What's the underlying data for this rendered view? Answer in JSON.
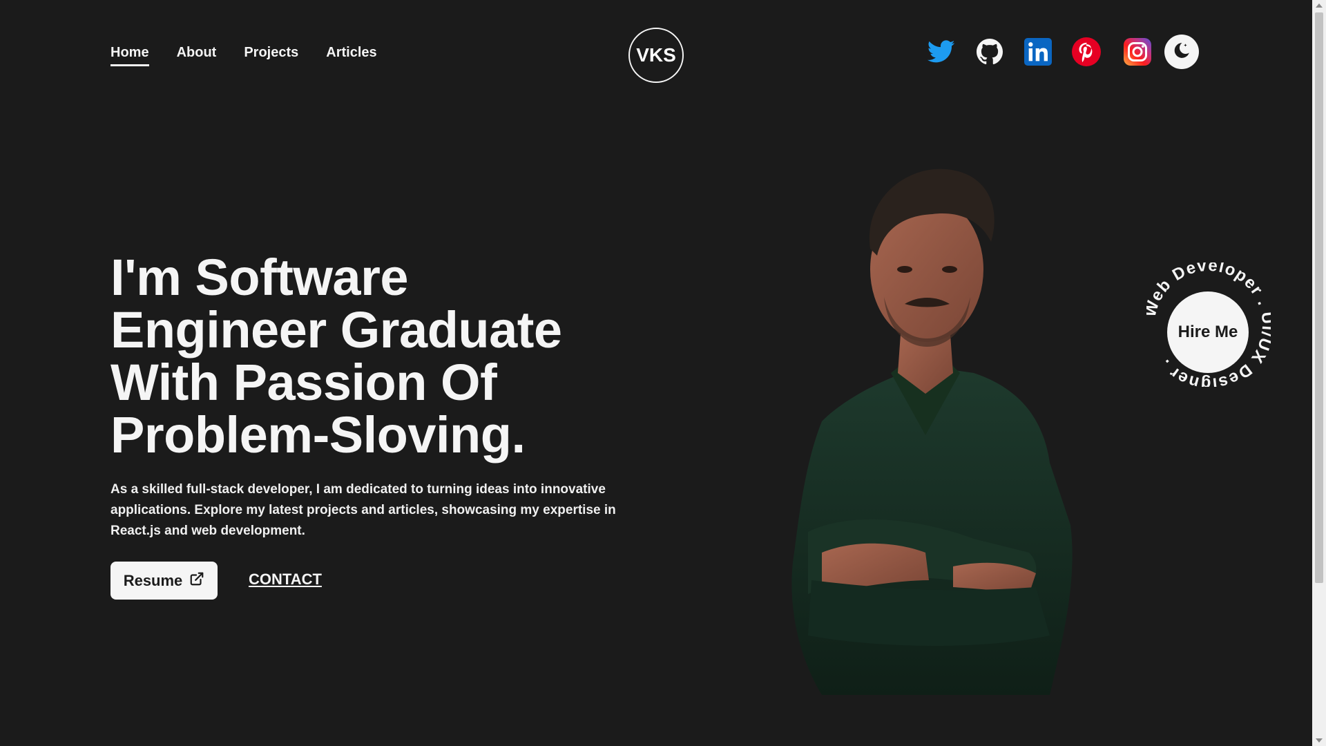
{
  "nav": {
    "items": [
      {
        "label": "Home",
        "active": true
      },
      {
        "label": "About",
        "active": false
      },
      {
        "label": "Projects",
        "active": false
      },
      {
        "label": "Articles",
        "active": false
      }
    ]
  },
  "logo": {
    "text": "VKS"
  },
  "social": {
    "icons": [
      "twitter-icon",
      "github-icon",
      "linkedin-icon",
      "pinterest-icon",
      "instagram-icon"
    ],
    "theme_icon": "moon-icon"
  },
  "hero": {
    "headline_lines": [
      "I'm Software",
      "Engineer Graduate",
      "With Passion Of",
      "Problem-Sloving."
    ],
    "intro": "As a skilled full-stack developer, I am dedicated to turning ideas into innovative applications. Explore my latest projects and articles, showcasing my expertise in React.js and web development.",
    "resume_label": "Resume",
    "contact_label": "CONTACT"
  },
  "hire": {
    "label": "Hire Me",
    "ring_text": "Web Developer . UI/UX Designer . "
  },
  "colors": {
    "background": "#1b1b1b",
    "foreground": "#f5f5f5",
    "twitter": "#1d9bf0",
    "linkedin": "#0a66c2",
    "pinterest": "#e60023"
  }
}
